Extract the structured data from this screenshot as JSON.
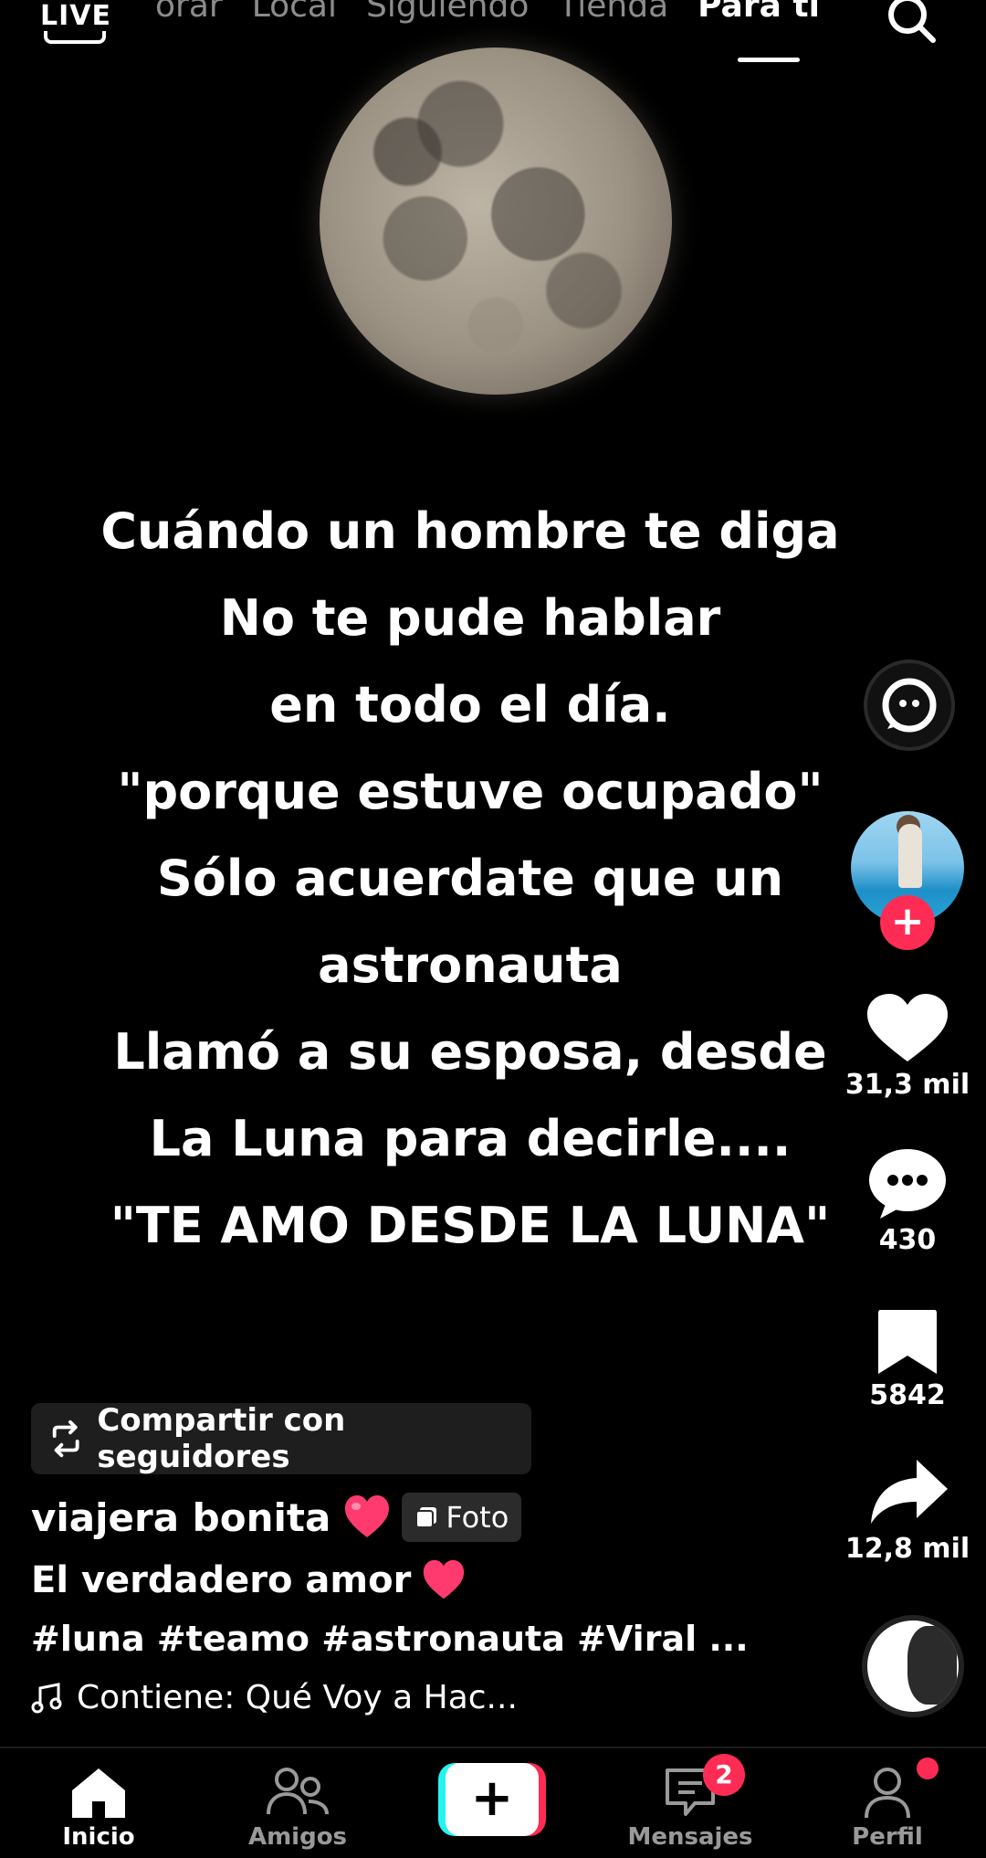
{
  "top_nav": {
    "live_label": "LIVE",
    "tabs": [
      {
        "label": "orar",
        "active": false
      },
      {
        "label": "Local",
        "active": false
      },
      {
        "label": "Siguiendo",
        "active": false
      },
      {
        "label": "Tienda",
        "active": false
      },
      {
        "label": "Para ti",
        "active": true
      }
    ],
    "search_icon": "search-icon"
  },
  "post": {
    "image_icon": "moon-image",
    "quote_lines": [
      "Cuándo un hombre te diga",
      "No te pude hablar",
      "en todo el día.",
      "\"porque estuve ocupado\"",
      "Sólo acuerdate que un",
      "astronauta",
      "Llamó a su esposa, desde",
      "La Luna para decirle....",
      "\"TE AMO DESDE LA LUNA\""
    ]
  },
  "actions": {
    "ai_icon": "ai-assistant-icon",
    "follow_icon": "plus-icon",
    "likes": "31,3 mil",
    "comments": "430",
    "saves": "5842",
    "shares": "12,8 mil"
  },
  "caption": {
    "share_label": "Compartir con seguidores",
    "username": "viajera bonita",
    "photo_badge": "Foto",
    "description": "El verdadero amor",
    "hashtags": "#luna #teamo #astronauta #Viral ...",
    "sound": "Contiene: Qué Voy a Hac..."
  },
  "bottom_nav": {
    "items": [
      {
        "label": "Inicio",
        "icon": "home-icon",
        "active": true
      },
      {
        "label": "Amigos",
        "icon": "friends-icon",
        "active": false
      },
      {
        "label": "Mensajes",
        "icon": "inbox-icon",
        "active": false
      },
      {
        "label": "Perfil",
        "icon": "profile-icon",
        "active": false
      }
    ],
    "messages_badge": "2"
  },
  "colors": {
    "accent": "#fe2c55",
    "cyan": "#25f4ee",
    "background": "#000000"
  }
}
